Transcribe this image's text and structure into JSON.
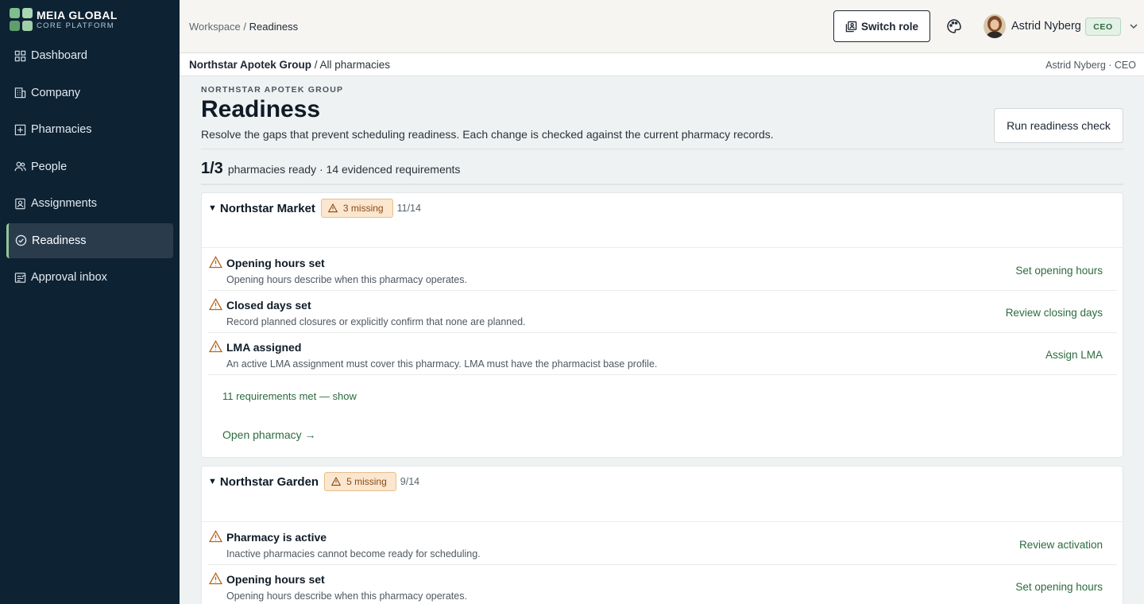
{
  "brand": {
    "name": "MEIA GLOBAL",
    "sub": "CORE PLATFORM"
  },
  "nav": {
    "items": [
      {
        "label": "Dashboard",
        "icon": "grid-icon"
      },
      {
        "label": "Company",
        "icon": "building-icon"
      },
      {
        "label": "Pharmacies",
        "icon": "pharmacy-icon"
      },
      {
        "label": "People",
        "icon": "people-icon"
      },
      {
        "label": "Assignments",
        "icon": "badge-icon"
      },
      {
        "label": "Readiness",
        "icon": "check-circle-icon"
      },
      {
        "label": "Approval inbox",
        "icon": "inbox-icon"
      }
    ],
    "active": "Readiness"
  },
  "header": {
    "breadcrumb_root": "Workspace",
    "breadcrumb_sep": " / ",
    "breadcrumb_current": "Readiness",
    "switch_role": "Switch role",
    "user_name": "Astrid Nyberg",
    "user_role": "CEO"
  },
  "subbar": {
    "org": "Northstar Apotek Group",
    "scope": " / All pharmacies",
    "identity": "Astrid Nyberg · CEO"
  },
  "page": {
    "eyebrow": "NORTHSTAR APOTEK GROUP",
    "title": "Readiness",
    "description": "Resolve the gaps that prevent scheduling readiness. Each change is checked against the current pharmacy records.",
    "run_button": "Run readiness check",
    "summary_count": "1/3",
    "summary_text": "pharmacies ready · 14 evidenced requirements"
  },
  "pharmacies": [
    {
      "name": "Northstar Market",
      "missing": "3 missing",
      "progress": "11/14",
      "requirements": [
        {
          "title": "Opening hours set",
          "desc": "Opening hours describe when this pharmacy operates.",
          "action": "Set opening hours"
        },
        {
          "title": "Closed days set",
          "desc": "Record planned closures or explicitly confirm that none are planned.",
          "action": "Review closing days"
        },
        {
          "title": "LMA assigned",
          "desc": "An active LMA assignment must cover this pharmacy. LMA must have the pharmacist base profile.",
          "action": "Assign LMA"
        }
      ],
      "met_link": "11 requirements met — show",
      "open_link": "Open pharmacy →"
    },
    {
      "name": "Northstar Garden",
      "missing": "5 missing",
      "progress": "9/14",
      "requirements": [
        {
          "title": "Pharmacy is active",
          "desc": "Inactive pharmacies cannot become ready for scheduling.",
          "action": "Review activation"
        },
        {
          "title": "Opening hours set",
          "desc": "Opening hours describe when this pharmacy operates.",
          "action": "Set opening hours"
        }
      ]
    }
  ],
  "colors": {
    "sidebar": "#0d2233",
    "accent": "#2c6b3e",
    "warning": "#b5651d"
  }
}
